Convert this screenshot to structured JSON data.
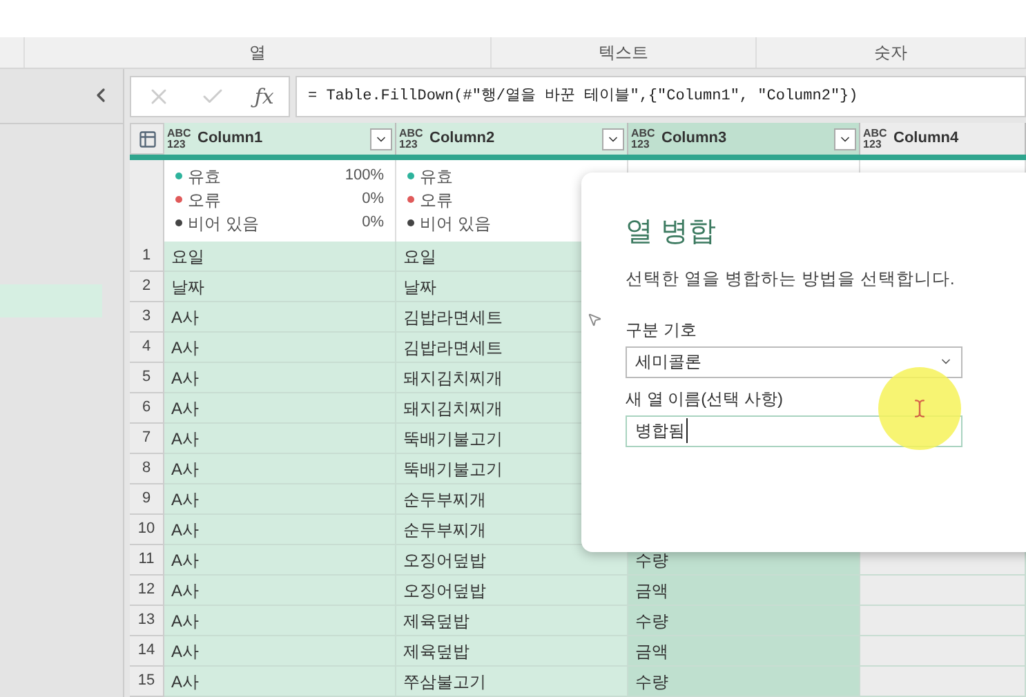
{
  "ribbon_groups": [
    {
      "label": "열"
    },
    {
      "label": "텍스트"
    },
    {
      "label": "숫자"
    }
  ],
  "formula_bar": {
    "fx_label": "ƒx",
    "formula": "= Table.FillDown(#\"행/열을 바꾼 테이블\",{\"Column1\", \"Column2\"})"
  },
  "table": {
    "columns": [
      {
        "type_label": "ABC 123",
        "name": "Column1",
        "selected": true,
        "active": false,
        "stats": [
          {
            "label": "유효",
            "value": "100%",
            "color": "#2db39c"
          },
          {
            "label": "오류",
            "value": "0%",
            "color": "#e05a5a"
          },
          {
            "label": "비어 있음",
            "value": "0%",
            "color": "#444444"
          }
        ]
      },
      {
        "type_label": "ABC 123",
        "name": "Column2",
        "selected": true,
        "active": false,
        "stats": [
          {
            "label": "유효",
            "color": "#2db39c"
          },
          {
            "label": "오류",
            "color": "#e05a5a"
          },
          {
            "label": "비어 있음",
            "color": "#444444"
          }
        ]
      },
      {
        "type_label": "ABC 123",
        "name": "Column3",
        "selected": true,
        "active": true
      },
      {
        "type_label": "ABC 123",
        "name": "Column4",
        "selected": false,
        "active": false
      }
    ],
    "rows": [
      {
        "num": "1",
        "cells": [
          "요일",
          "요일"
        ]
      },
      {
        "num": "2",
        "cells": [
          "날짜",
          "날짜"
        ]
      },
      {
        "num": "3",
        "cells": [
          "A사",
          "김밥라면세트"
        ]
      },
      {
        "num": "4",
        "cells": [
          "A사",
          "김밥라면세트"
        ]
      },
      {
        "num": "5",
        "cells": [
          "A사",
          "돼지김치찌개"
        ]
      },
      {
        "num": "6",
        "cells": [
          "A사",
          "돼지김치찌개"
        ]
      },
      {
        "num": "7",
        "cells": [
          "A사",
          "뚝배기불고기"
        ]
      },
      {
        "num": "8",
        "cells": [
          "A사",
          "뚝배기불고기"
        ]
      },
      {
        "num": "9",
        "cells": [
          "A사",
          "순두부찌개"
        ]
      },
      {
        "num": "10",
        "cells": [
          "A사",
          "순두부찌개"
        ]
      },
      {
        "num": "11",
        "cells": [
          "A사",
          "오징어덮밥",
          "수량"
        ]
      },
      {
        "num": "12",
        "cells": [
          "A사",
          "오징어덮밥",
          "금액"
        ]
      },
      {
        "num": "13",
        "cells": [
          "A사",
          "제육덮밥",
          "수량"
        ]
      },
      {
        "num": "14",
        "cells": [
          "A사",
          "제육덮밥",
          "금액"
        ]
      },
      {
        "num": "15",
        "cells": [
          "A사",
          "쭈삼불고기",
          "수량"
        ]
      }
    ]
  },
  "dialog": {
    "title": "열 병합",
    "description": "선택한 열을 병합하는 방법을 선택합니다.",
    "separator_label": "구분 기호",
    "separator_value": "세미콜론",
    "name_label": "새 열 이름(선택 사항)",
    "name_value": "병합됨"
  }
}
